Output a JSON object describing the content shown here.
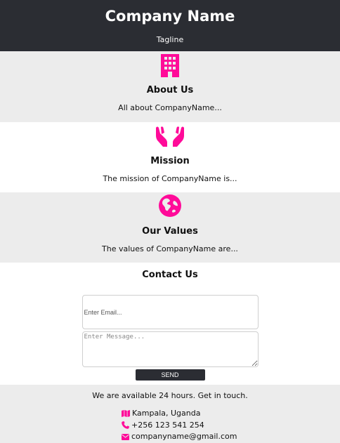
{
  "header": {
    "title": "Company Name",
    "tagline": "Tagline"
  },
  "accent_color": "#ff0b99",
  "dark_color": "#2b2d33",
  "about": {
    "icon": "building-icon",
    "heading": "About Us",
    "text": "All about CompanyName..."
  },
  "mission": {
    "icon": "hands-icon",
    "heading": "Mission",
    "text": "The mission of CompanyName is..."
  },
  "values": {
    "icon": "globe-icon",
    "heading": "Our Values",
    "text": "The values of CompanyName are..."
  },
  "contact": {
    "heading": "Contact Us",
    "email_placeholder": "Enter Email...",
    "message_placeholder": "Enter Message...",
    "send_label": "SEND"
  },
  "footer": {
    "availability": "We are available 24 hours. Get in touch.",
    "items": [
      {
        "icon": "map-icon",
        "text": "Kampala, Uganda"
      },
      {
        "icon": "phone-icon",
        "text": "+256 123 541 254"
      },
      {
        "icon": "envelope-icon",
        "text": "companyname@gmail.com"
      }
    ]
  }
}
